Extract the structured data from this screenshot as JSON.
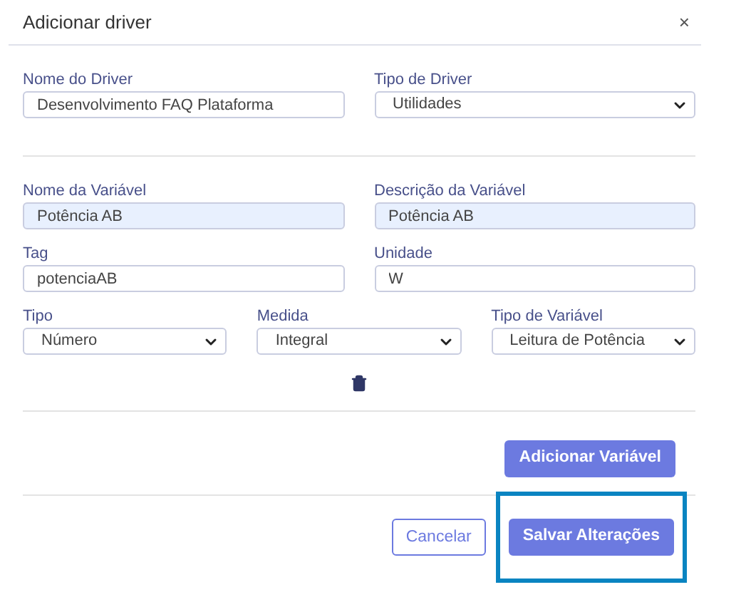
{
  "dialog": {
    "title": "Adicionar driver",
    "close": "×"
  },
  "driver_fields": [
    {
      "kind": "text",
      "label": "Nome do Driver",
      "value": "Desenvolvimento FAQ Plataforma",
      "autofilled": false
    },
    {
      "kind": "select",
      "label": "Tipo de Driver",
      "value": "Utilidades",
      "autofilled": false
    }
  ],
  "variable_rows": [
    [
      {
        "kind": "text",
        "label": "Nome da Variável",
        "value": "Potência AB",
        "autofilled": true
      },
      {
        "kind": "text",
        "label": "Descrição da Variável",
        "value": "Potência AB",
        "autofilled": true
      }
    ],
    [
      {
        "kind": "text",
        "label": "Tag",
        "value": "potenciaAB",
        "autofilled": false
      },
      {
        "kind": "text",
        "label": "Unidade",
        "value": "W",
        "autofilled": false
      }
    ],
    [
      {
        "kind": "select",
        "label": "Tipo",
        "value": "Número",
        "autofilled": false
      },
      {
        "kind": "select",
        "label": "Medida",
        "value": "Integral",
        "autofilled": false
      },
      {
        "kind": "select",
        "label": "Tipo de Variável",
        "value": "Leitura de Potência",
        "autofilled": false
      }
    ]
  ],
  "add_variable_button": "Adicionar Variável",
  "footer_buttons": [
    {
      "kind": "outline",
      "label": "Cancelar",
      "highlighted": false
    },
    {
      "kind": "primary",
      "label": "Salvar Alterações",
      "highlighted": true
    }
  ]
}
